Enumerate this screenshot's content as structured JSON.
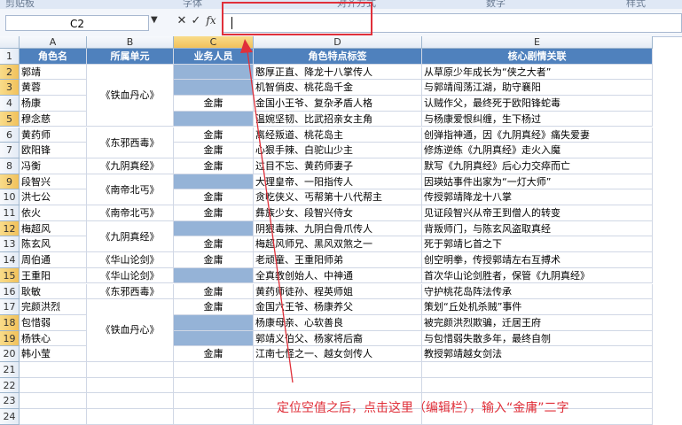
{
  "ribbon": {
    "groups": [
      "剪贴板",
      "字体",
      "对齐方式",
      "数字",
      "样式"
    ]
  },
  "formula_bar": {
    "name_box": "C2",
    "cancel": "✕",
    "enter": "✓",
    "fx": "fx",
    "content": ""
  },
  "columns": [
    "A",
    "B",
    "C",
    "D",
    "E"
  ],
  "headers": [
    "角色名",
    "所属单元",
    "业务人员",
    "角色特点标签",
    "核心剧情关联"
  ],
  "rows": [
    {
      "n": "2",
      "a": "郭靖",
      "c": "",
      "d": "憨厚正直、降龙十八掌传人",
      "e": "从草原少年成长为“侠之大者”"
    },
    {
      "n": "3",
      "a": "黄蓉",
      "c": "",
      "d": "机智俏皮、桃花岛千金",
      "e": "与郭靖闯荡江湖，助守襄阳"
    },
    {
      "n": "4",
      "a": "杨康",
      "c": "金庸",
      "d": "金国小王爷、复杂矛盾人格",
      "e": "认贼作父，最终死于欧阳锋蛇毒"
    },
    {
      "n": "5",
      "a": "穆念慈",
      "c": "",
      "d": "温婉坚韧、比武招亲女主角",
      "e": "与杨康爱恨纠缠，生下杨过"
    },
    {
      "n": "6",
      "a": "黄药师",
      "c": "金庸",
      "d": "离经叛道、桃花岛主",
      "e": "创弹指神通，因《九阴真经》痛失爱妻"
    },
    {
      "n": "7",
      "a": "欧阳锋",
      "c": "金庸",
      "d": "心狠手辣、白驼山少主",
      "e": "修炼逆练《九阴真经》走火入魔"
    },
    {
      "n": "8",
      "a": "冯衡",
      "c": "金庸",
      "d": "过目不忘、黄药师妻子",
      "e": "默写《九阴真经》后心力交瘁而亡"
    },
    {
      "n": "9",
      "a": "段智兴",
      "c": "",
      "d": "大理皇帝、一阳指传人",
      "e": "因瑛姑事件出家为“一灯大师”"
    },
    {
      "n": "10",
      "a": "洪七公",
      "c": "金庸",
      "d": "贪吃侠义、丐帮第十八代帮主",
      "e": "传授郭靖降龙十八掌"
    },
    {
      "n": "11",
      "a": "依火",
      "c": "金庸",
      "d": "彝族少女、段智兴侍女",
      "e": "见证段智兴从帝王到僧人的转变"
    },
    {
      "n": "12",
      "a": "梅超风",
      "c": "",
      "d": "阴狠毒辣、九阴白骨爪传人",
      "e": "背叛师门，与陈玄风盗取真经"
    },
    {
      "n": "13",
      "a": "陈玄风",
      "c": "金庸",
      "d": "梅超风师兄、黑风双煞之一",
      "e": "死于郭靖匕首之下"
    },
    {
      "n": "14",
      "a": "周伯通",
      "c": "金庸",
      "d": "老顽童、王重阳师弟",
      "e": "创空明拳，传授郭靖左右互搏术"
    },
    {
      "n": "15",
      "a": "王重阳",
      "c": "",
      "d": "全真教创始人、中神通",
      "e": "首次华山论剑胜者，保管《九阴真经》"
    },
    {
      "n": "16",
      "a": "耿敏",
      "c": "金庸",
      "d": "黄药师徒孙、程英师姐",
      "e": "守护桃花岛阵法传承"
    },
    {
      "n": "17",
      "a": "完颜洪烈",
      "c": "金庸",
      "d": "金国六王爷、杨康养父",
      "e": "策划“丘处机杀贼”事件"
    },
    {
      "n": "18",
      "a": "包惜弱",
      "c": "",
      "d": "杨康母亲、心软善良",
      "e": "被完颜洪烈欺骗，迁居王府"
    },
    {
      "n": "19",
      "a": "杨铁心",
      "c": "",
      "d": "郭靖义伯父、杨家将后裔",
      "e": "与包惜弱失散多年，最终自刎"
    },
    {
      "n": "20",
      "a": "韩小莹",
      "c": "金庸",
      "d": "江南七怪之一、越女剑传人",
      "e": "教授郭靖越女剑法"
    }
  ],
  "units": [
    {
      "label": "《铁血丹心》"
    },
    {
      "label": "《东邪西毒》"
    },
    {
      "label": "《九阴真经》"
    },
    {
      "label": "《南帝北丐》"
    },
    {
      "label": "《南帝北丐》"
    },
    {
      "label": "《九阴真经》"
    },
    {
      "label": "《华山论剑》"
    },
    {
      "label": "《华山论剑》"
    },
    {
      "label": "《东邪西毒》"
    },
    {
      "label": "《铁血丹心》"
    }
  ],
  "empty_rows": [
    "21",
    "22",
    "23",
    "24"
  ],
  "annotation": "定位空值之后，点击这里（编辑栏），输入“金庸”二字",
  "colors": {
    "header_fill": "#4f81bd",
    "blank_fill": "#95b3d7",
    "annotation": "#e0303a",
    "selected_header": "#f1c15b"
  }
}
